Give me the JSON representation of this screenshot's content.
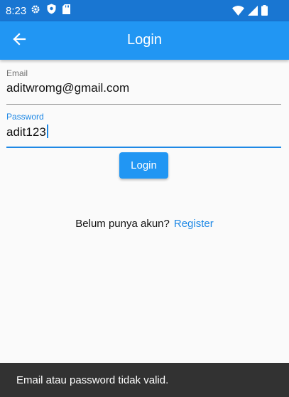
{
  "status_bar": {
    "time": "8:23",
    "left_icons": [
      "gear-icon",
      "shield-icon",
      "sd-card-icon"
    ],
    "right_icons": [
      "wifi-icon",
      "signal-icon",
      "battery-icon"
    ]
  },
  "app_bar": {
    "title": "Login",
    "back_icon": "arrow-left-icon",
    "color": "#2196f3"
  },
  "form": {
    "email": {
      "label": "Email",
      "value": "aditwromg@gmail.com"
    },
    "password": {
      "label": "Password",
      "value": "adit123"
    },
    "login_button": "Login"
  },
  "register": {
    "prompt": "Belum punya akun?",
    "link": "Register"
  },
  "snackbar": {
    "message": "Email atau password tidak valid."
  },
  "colors": {
    "primary": "#2196f3",
    "status_bar": "#1976d2",
    "snackbar": "#323232"
  }
}
